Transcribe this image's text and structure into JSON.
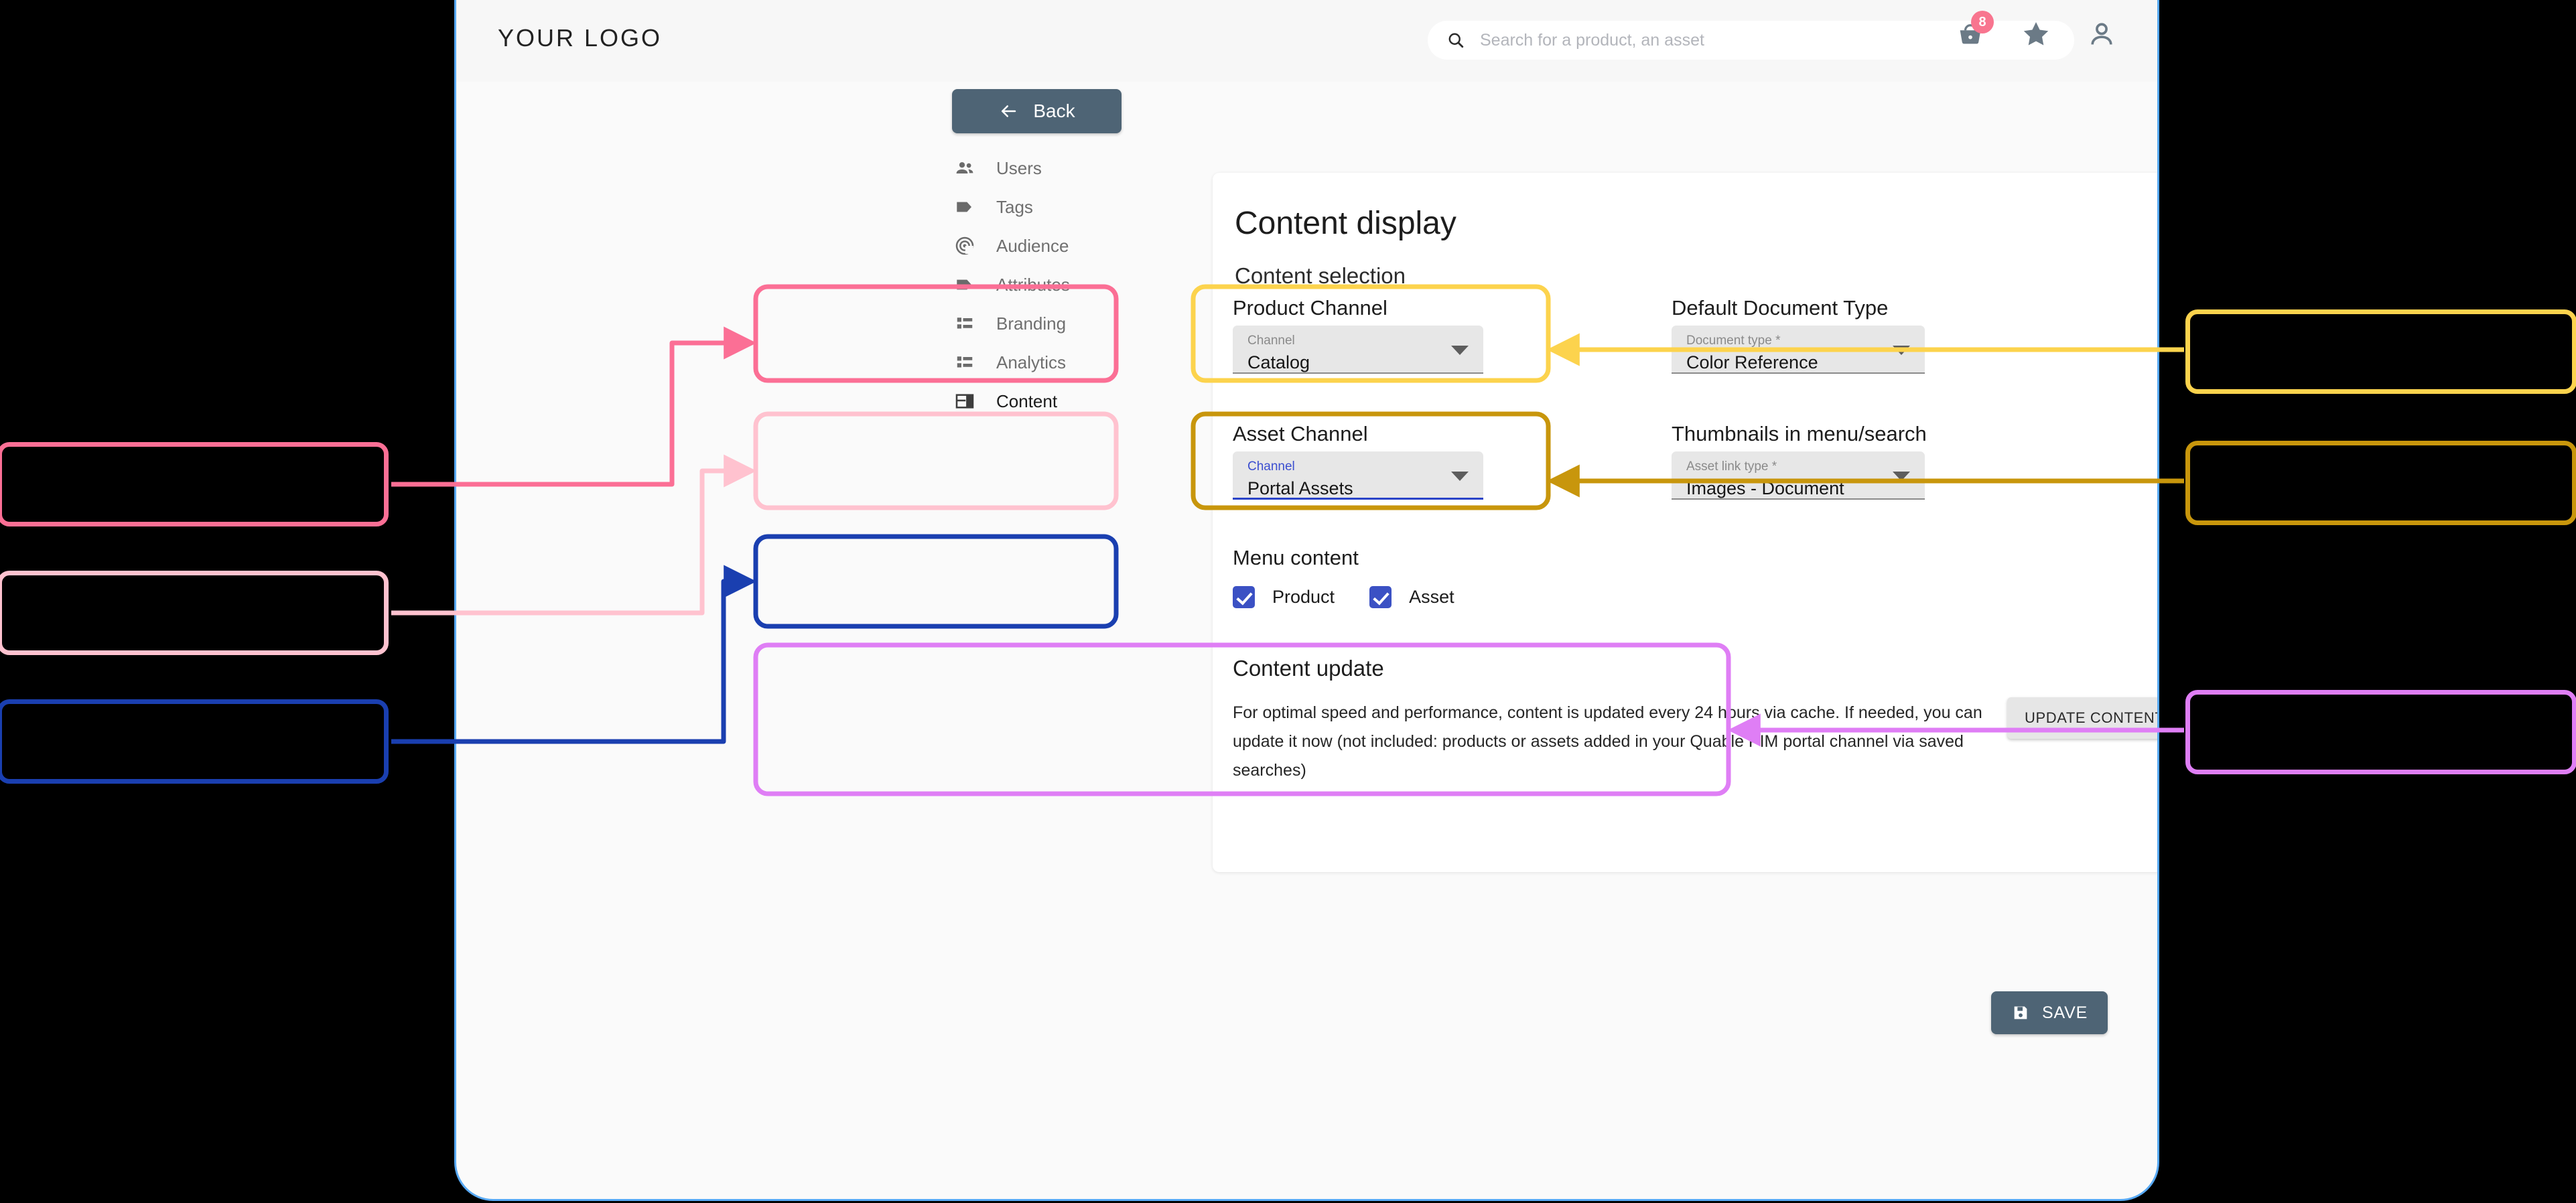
{
  "window": {
    "brand_logo": "YOUR LOGO",
    "frame_border_color": "#57a9f5"
  },
  "header": {
    "search": {
      "placeholder": "Search for a product, an asset",
      "value": "",
      "icon": "search-icon"
    },
    "icons": [
      {
        "name": "cart-icon",
        "badge": "8",
        "badge_color": "#f8758f"
      },
      {
        "name": "star-icon"
      },
      {
        "name": "account-icon"
      }
    ]
  },
  "back_button": {
    "label": "Back",
    "icon": "arrow-left-icon",
    "color": "#4e6475"
  },
  "sidebar": {
    "items": [
      {
        "label": "Users",
        "icon": "people-icon",
        "active": false
      },
      {
        "label": "Tags",
        "icon": "tag-icon",
        "active": false
      },
      {
        "label": "Audience",
        "icon": "broadcast-icon",
        "active": false
      },
      {
        "label": "Attributes",
        "icon": "tag-icon",
        "active": false
      },
      {
        "label": "Branding",
        "icon": "list-icon",
        "active": false
      },
      {
        "label": "Analytics",
        "icon": "list-icon",
        "active": false
      },
      {
        "label": "Content",
        "icon": "layout-icon",
        "active": true
      }
    ]
  },
  "main": {
    "page_title": "Content display",
    "section_subtitle": "Content selection",
    "product_channel": {
      "title": "Product Channel",
      "field_label": "Channel",
      "value": "Catalog",
      "focused": false,
      "highlight_color": "#fb6f95"
    },
    "default_document_type": {
      "title": "Default Document Type",
      "field_label": "Document type *",
      "value": "Color Reference",
      "focused": false,
      "highlight_color": "#fcd34d"
    },
    "asset_channel": {
      "title": "Asset Channel",
      "field_label": "Channel",
      "value": "Portal Assets",
      "focused": true,
      "highlight_color": "#ffc2cf"
    },
    "thumbnails": {
      "title": "Thumbnails in menu/search",
      "field_label": "Asset link type *",
      "value": "Images - Document",
      "focused": false,
      "highlight_color": "#c8960c"
    },
    "menu_content": {
      "title": "Menu content",
      "highlight_color": "#1a3fb0",
      "checkboxes": [
        {
          "label": "Product",
          "checked": true
        },
        {
          "label": "Asset",
          "checked": true
        }
      ]
    },
    "content_update": {
      "title": "Content update",
      "text": "For optimal speed and performance, content is updated every 24 hours via cache. If needed, you can update it now (not included: products or assets added in your Quable PIM portal channel via saved searches)",
      "button_label": "UPDATE CONTENT",
      "highlight_color": "#df7ef5"
    },
    "save_button": {
      "label": "SAVE",
      "icon": "save-icon",
      "color": "#4e6475"
    }
  },
  "annotations": {
    "left": [
      {
        "name": "callout-product-channel",
        "color": "#fb6f95"
      },
      {
        "name": "callout-asset-channel",
        "color": "#ffc2cf"
      },
      {
        "name": "callout-menu-content",
        "color": "#1a3fb0"
      }
    ],
    "right": [
      {
        "name": "callout-default-document-type",
        "color": "#fcd34d"
      },
      {
        "name": "callout-thumbnails",
        "color": "#c8960c"
      },
      {
        "name": "callout-content-update",
        "color": "#df7ef5"
      }
    ]
  }
}
